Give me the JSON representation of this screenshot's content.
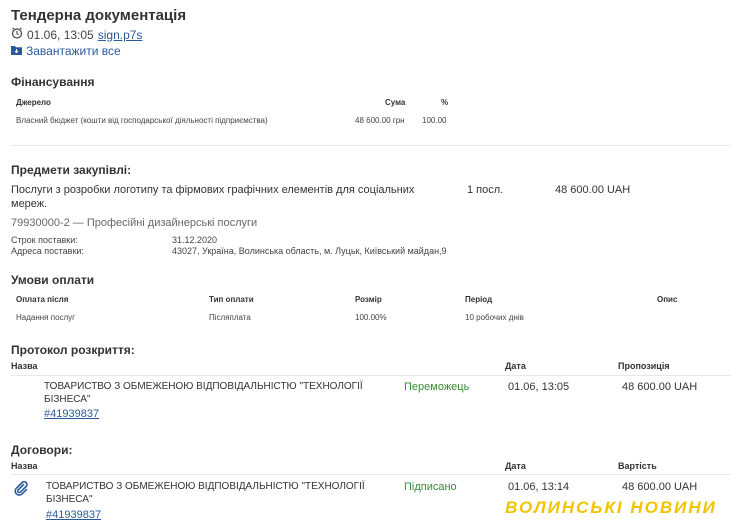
{
  "header": {
    "title": "Тендерна документація",
    "date": "01.06, 13:05",
    "file_link": "sign.p7s",
    "download_all": "Завантажити все"
  },
  "financing": {
    "heading": "Фінансування",
    "columns": [
      "Джерело",
      "Сума",
      "%"
    ],
    "row": {
      "source": "Власний бюджет (кошти від господарської діяльності підприємства)",
      "amount": "48 600.00 грн",
      "percent": "100.00"
    }
  },
  "items": {
    "heading": "Предмети закупівлі:",
    "description": "Послуги з розробки логотипу та фірмових графічних елементів для соціальних мереж.",
    "description_line1": "Послуги з розробки логотипу та фірмових графічних елементів для соціальних",
    "description_line2": "мереж.",
    "quantity": "1 посл.",
    "price": "48 600.00 UAH",
    "classification": "79930000-2 — Професійні дизайнерські послуги",
    "delivery_date_label": "Строк поставки:",
    "delivery_date": "31.12.2020",
    "delivery_address_label": "Адреса поставки:",
    "delivery_address": "43027, Україна, Волинська область, м. Луцьк, Київський майдан,9"
  },
  "payment": {
    "heading": "Умови оплати",
    "columns": [
      "Оплата після",
      "Тип оплати",
      "Розмір",
      "Період",
      "Опис"
    ],
    "row": {
      "after": "Надання послуг",
      "type": "Післяплата",
      "size": "100.00%",
      "period": "10 робочих днів",
      "description": ""
    }
  },
  "protocol": {
    "heading": "Протокол розкриття:",
    "columns": [
      "Назва",
      "Дата",
      "Пропозиція"
    ],
    "row": {
      "name_line1": "ТОВАРИСТВО З ОБМЕЖЕНОЮ ВІДПОВІДАЛЬНІСТЮ \"ТЕХНОЛОГІЇ",
      "name_line2": "БІЗНЕСА\"",
      "id": "#41939837",
      "status": "Переможець",
      "date": "01.06, 13:05",
      "offer": "48 600.00 UAH"
    }
  },
  "contracts": {
    "heading": "Договори:",
    "columns": [
      "Назва",
      "Дата",
      "Вартість"
    ],
    "row": {
      "name_line1": "ТОВАРИСТВО З ОБМЕЖЕНОЮ ВІДПОВІДАЛЬНІСТЮ \"ТЕХНОЛОГІЇ",
      "name_line2": "БІЗНЕСА\"",
      "id": "#41939837",
      "status": "Підписано",
      "date": "01.06, 13:14",
      "value": "48 600.00 UAH"
    }
  },
  "watermark": "ВОЛИНСЬКІ НОВИНИ",
  "colors": {
    "link": "#2a5a9a",
    "status_green": "#3a8a3a",
    "watermark": "#f0c400"
  }
}
